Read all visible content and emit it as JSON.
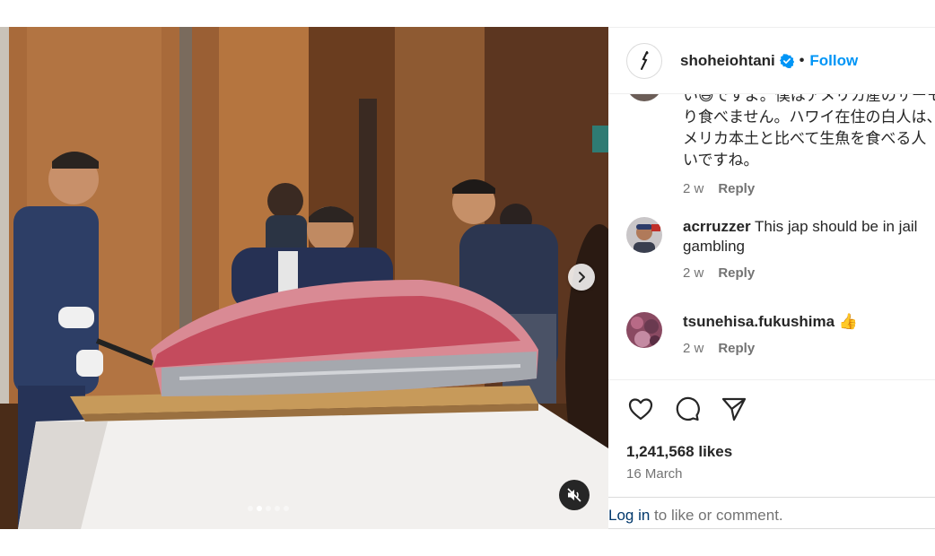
{
  "post": {
    "username": "shoheiohtani",
    "separator": "•",
    "follow_label": "Follow",
    "verified_icon": "verified-badge-icon"
  },
  "media": {
    "carousel_count": 5,
    "active_index": 1,
    "next_icon": "chevron-right-icon",
    "mute_icon": "speaker-muted-icon"
  },
  "comments": {
    "truncated_lines": [
      "い😅ですよ。僕はアメリカ産のサーモ",
      "り食べません。ハワイ在住の白人は、",
      "メリカ本土と比べて生魚を食べる人",
      "いですね。"
    ],
    "truncated_meta": {
      "time": "2 w",
      "reply": "Reply"
    },
    "items": [
      {
        "user": "acrruzzer",
        "text_line1": " This jap should be in jail",
        "text_line2": "gambling",
        "time": "2 w",
        "reply": "Reply"
      },
      {
        "user": "tsunehisa.fukushima",
        "text_line1": " 👍",
        "time": "2 w",
        "reply": "Reply"
      }
    ]
  },
  "actions": {
    "like_icon": "heart-icon",
    "comment_icon": "comment-bubble-icon",
    "share_icon": "paper-plane-icon",
    "likes": "1,241,568 likes",
    "date": "16 March"
  },
  "login": {
    "link": "Log in",
    "text": " to like or comment."
  },
  "colors": {
    "accent": "#0095f6",
    "link_dark": "#00376b",
    "muted_text": "#737373"
  }
}
